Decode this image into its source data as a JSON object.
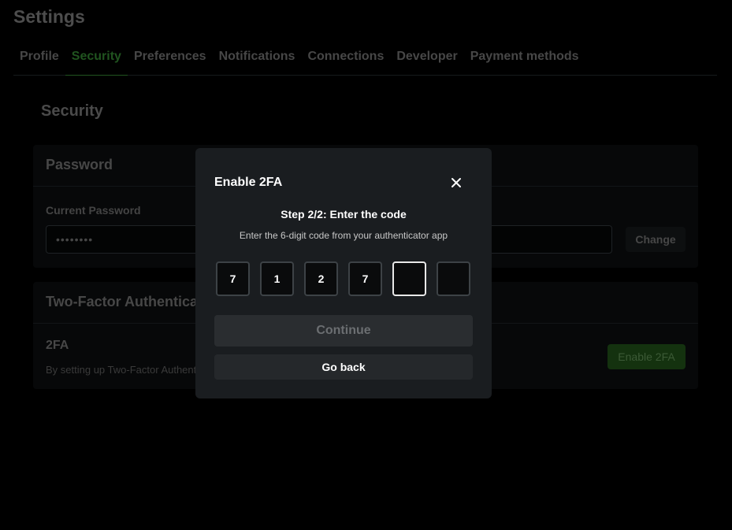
{
  "page": {
    "title": "Settings"
  },
  "tabs": [
    {
      "label": "Profile"
    },
    {
      "label": "Security",
      "active": true
    },
    {
      "label": "Preferences"
    },
    {
      "label": "Notifications"
    },
    {
      "label": "Connections"
    },
    {
      "label": "Developer"
    },
    {
      "label": "Payment methods"
    }
  ],
  "section": {
    "title": "Security"
  },
  "password_card": {
    "title": "Password",
    "current_label": "Current Password",
    "current_value": "••••••••",
    "change_label": "Change"
  },
  "tfa_card": {
    "title": "Two-Factor Authentication",
    "name": "2FA",
    "description": "By setting up Two-Factor Authentication",
    "enable_label": "Enable 2FA"
  },
  "modal": {
    "title": "Enable 2FA",
    "step": "Step 2/2: Enter the code",
    "description": "Enter the 6-digit code from your authenticator app",
    "code": [
      "7",
      "1",
      "2",
      "7",
      "",
      ""
    ],
    "focused_index": 4,
    "continue_label": "Continue",
    "go_back_label": "Go back"
  },
  "colors": {
    "accent": "#20541f",
    "modal_bg": "#1a1d20",
    "page_bg": "#000000"
  }
}
